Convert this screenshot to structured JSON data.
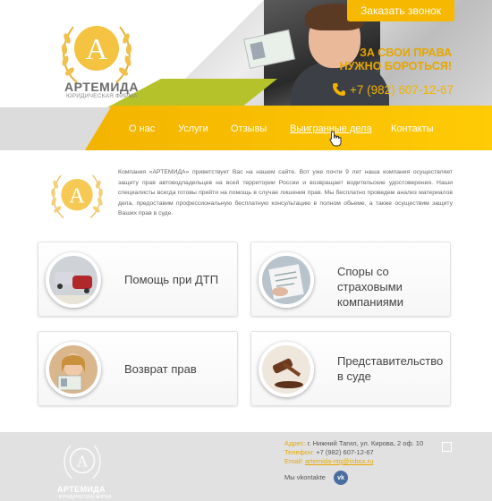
{
  "brand": {
    "name": "АРТЕМИДА",
    "subtitle": "ЮРИДИЧЕСКАЯ ФИРМА",
    "logo_letter": "A",
    "accent_color": "#ffc300"
  },
  "header": {
    "call_button": "Заказать звонок",
    "slogan_line1": "ЗА СВОИ ПРАВА",
    "slogan_line2": "НУЖНО БОРОТЬСЯ!",
    "phone": "+7 (982) 607-12-67",
    "phone_icon": "phone-handset-icon"
  },
  "nav": {
    "items": [
      {
        "label": "О нас"
      },
      {
        "label": "Услуги"
      },
      {
        "label": "Отзывы"
      },
      {
        "label": "Выигранные дела"
      },
      {
        "label": "Контакты"
      }
    ]
  },
  "intro": {
    "text": "Компания «АРТЕМИДА» приветствует Вас на нашем сайте. Вот уже почти 9 лет наша компания осуществляет защиту прав автоводладельцев на всей территории России и возвращает водительские удостоверения. Наши специалисты всегда готовы прийти на помощь в случае лишения прав. Мы бесплатно проведем анализ материалов дела, предоставим профессиональную бесплатную консультацию в полном обьеме, а также осуществим защиту Ваших прав в суде."
  },
  "services": [
    {
      "label_line1": "Помощь при ДТП",
      "label_line2": ""
    },
    {
      "label_line1": "Споры со страховыми",
      "label_line2": "компаниями"
    },
    {
      "label_line1": "Возврат прав",
      "label_line2": ""
    },
    {
      "label_line1": "Представительство",
      "label_line2": "в суде"
    }
  ],
  "footer": {
    "brand_name": "АРТЕМИДА",
    "brand_sub": "ЮРИДИЧЕСКАЯ ФИРМА",
    "address_label": "Адрес:",
    "address": "г. Нижний Тагил, ул. Кирова, 2 оф. 10",
    "phone_label": "Телефон:",
    "phone": "+7 (982) 607-12-67",
    "email_label": "Email:",
    "email": "artemida-ntg@inbox.ru",
    "social_label": "Мы vkontakte",
    "vk_icon_text": "vk"
  }
}
